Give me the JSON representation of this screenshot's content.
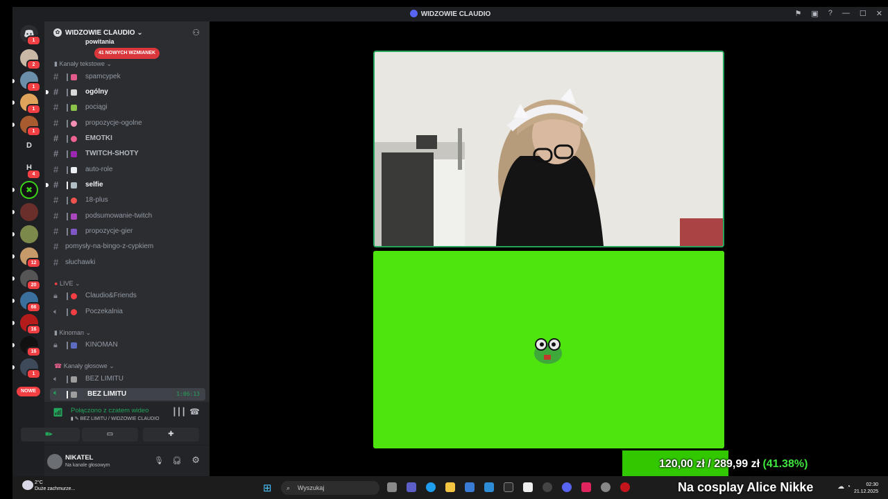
{
  "window": {
    "title": "WIDZOWIE CLAUDIO"
  },
  "guild": {
    "name": "WIDZOWIE CLAUDIO",
    "mentions_pill": "41 NOWYCH WZMIANEK",
    "top_clip": "powitania"
  },
  "rail": {
    "servers": [
      {
        "badge": "1"
      },
      {
        "badge": "2"
      },
      {
        "badge": "1"
      },
      {
        "badge": "1"
      },
      {
        "letter": "D",
        "badge": ""
      },
      {
        "letter": "H",
        "badge": "4"
      },
      {
        "badge": ""
      },
      {
        "badge": ""
      },
      {
        "badge": ""
      },
      {
        "badge": "12"
      },
      {
        "badge": "20"
      },
      {
        "badge": "66"
      },
      {
        "badge": "16"
      },
      {
        "badge": "16"
      },
      {
        "badge": "1"
      }
    ],
    "new_label": "NOWE"
  },
  "categories": {
    "text": "Kanały tekstowe",
    "live": "LIVE",
    "kinoman": "Kinoman",
    "voice": "Kanały głosowe"
  },
  "channels": [
    {
      "name": "spamcypek"
    },
    {
      "name": "ogólny"
    },
    {
      "name": "pociągi"
    },
    {
      "name": "propozycje-ogolne"
    },
    {
      "name": "EMOTKI"
    },
    {
      "name": "TWITCH-SHOTY"
    },
    {
      "name": "auto-role"
    },
    {
      "name": "selfie"
    },
    {
      "name": "18-plus"
    },
    {
      "name": "podsumowanie-twitch"
    },
    {
      "name": "propozycje-gier"
    },
    {
      "name": "pomysły-na-bingo-z-cypkiem"
    },
    {
      "name": "słuchawki"
    },
    {
      "name": "Claudio&Friends"
    },
    {
      "name": "Poczekalnia"
    },
    {
      "name": "KINOMAN"
    },
    {
      "name": "BEZ LIMITU"
    },
    {
      "name": "BEZ LIMITU"
    }
  ],
  "voice": {
    "timer": "1:06:13",
    "status": "Połączono z czatem wideo",
    "location": "BEZ LIMITU / WIDZOWIE CLAUDIO"
  },
  "user": {
    "name": "NIKATEL",
    "status": "Na kanale głosowym"
  },
  "donation": {
    "amount": "120,00 zł",
    "sep": "/",
    "goal": "289,99 zł",
    "percent": "(41.38%)"
  },
  "taskbar": {
    "weather_temp": "2°C",
    "weather_desc": "Duże zachmurze...",
    "search_placeholder": "Wyszukaj",
    "overlay_text": "Na cosplay Alice Nikke",
    "time": "02:30",
    "date": "21.12.2025"
  },
  "colors": {
    "accent": "#5865f2",
    "online": "#23a55a",
    "mention": "#f23f43",
    "greenscreen": "#4ee40e"
  }
}
